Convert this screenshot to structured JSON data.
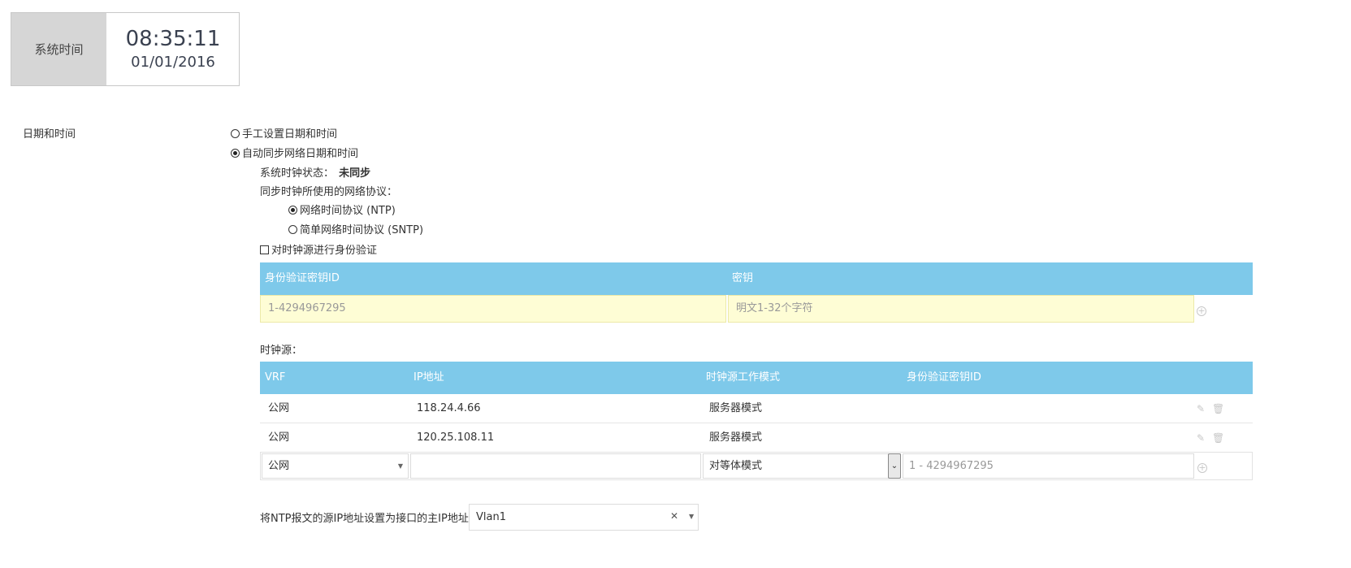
{
  "system_time": {
    "label": "系统时间",
    "clock": "08:35:11",
    "date": "01/01/2016"
  },
  "date_time": {
    "label": "日期和时间",
    "manual_option": "手工设置日期和时间",
    "auto_option": "自动同步网络日期和时间",
    "clock_status_label": "系统时钟状态：",
    "clock_status_value": "未同步",
    "protocol_label": "同步时钟所使用的网络协议：",
    "ntp_option": "网络时间协议 (NTP)",
    "sntp_option": "简单网络时间协议 (SNTP)",
    "auth_checkbox": "对时钟源进行身份验证"
  },
  "auth_table": {
    "columns": [
      "身份验证密钥ID",
      "密钥"
    ],
    "key_id_placeholder": "1-4294967295",
    "key_placeholder": "明文1-32个字符"
  },
  "clock_source": {
    "label": "时钟源：",
    "columns": [
      "VRF",
      "IP地址",
      "时钟源工作模式",
      "身份验证密钥ID"
    ],
    "rows": [
      {
        "vrf": "公网",
        "ip": "118.24.4.66",
        "mode": "服务器模式",
        "key_id": ""
      },
      {
        "vrf": "公网",
        "ip": "120.25.108.11",
        "mode": "服务器模式",
        "key_id": ""
      }
    ],
    "new_row": {
      "vrf": "公网",
      "ip": "",
      "mode": "对等体模式",
      "key_id_placeholder": "1 - 4294967295"
    }
  },
  "source_ip": {
    "label": "将NTP报文的源IP地址设置为接口的主IP地址",
    "value": "Vlan1"
  },
  "icons": {
    "add": "plus-circle-icon",
    "edit": "edit-icon",
    "delete": "trash-icon",
    "dropdown": "chevron-down-icon",
    "clear": "close-icon"
  },
  "colors": {
    "table_header": "#7ec9ea",
    "input_highlight": "#fefdd5",
    "time_label_bg": "#d6d6d6"
  }
}
